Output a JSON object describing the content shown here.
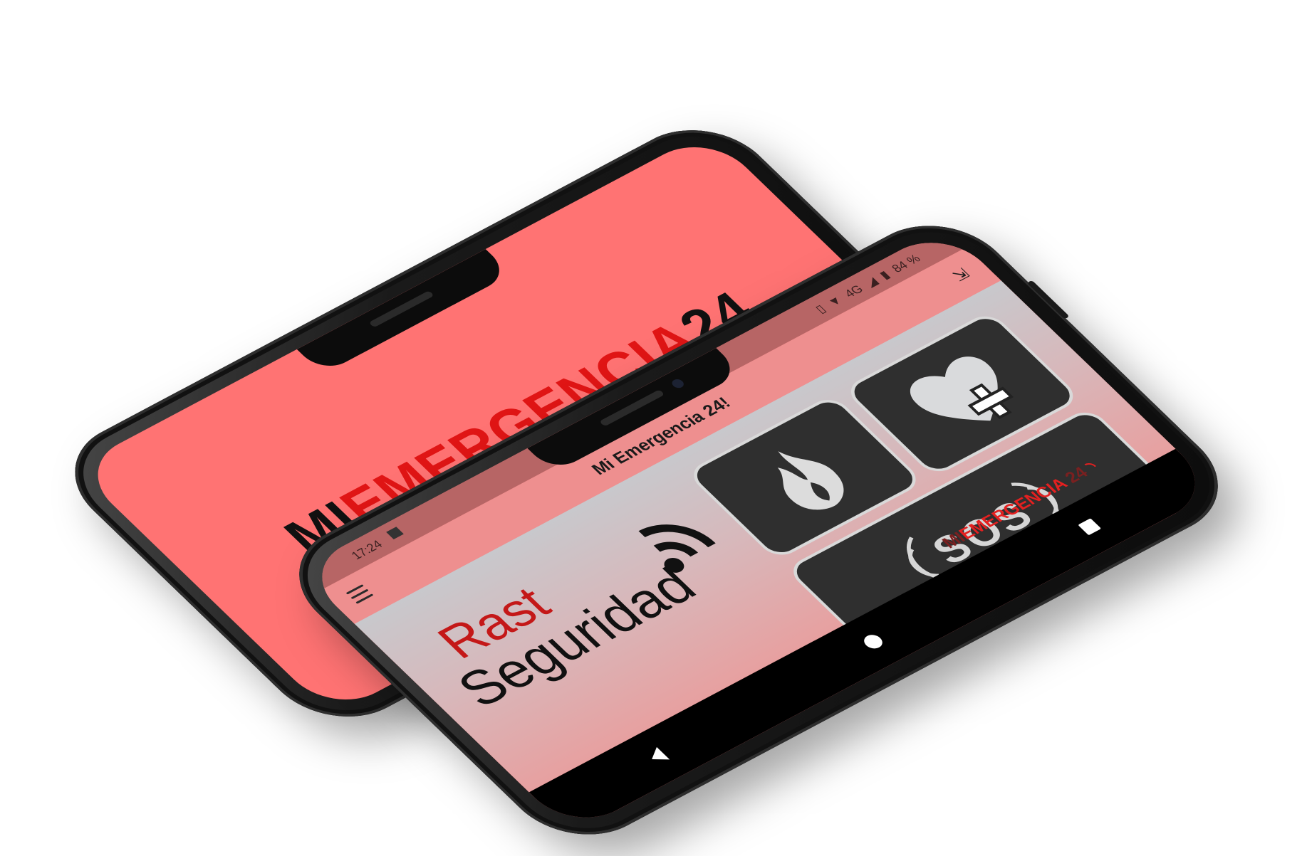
{
  "splash": {
    "brand_prefix": "MI",
    "brand_main": "EMERGENCIA",
    "brand_number": "24"
  },
  "status_bar": {
    "time": "17:24",
    "network": "4G",
    "battery": "84 %"
  },
  "app_bar": {
    "title": "Mi Emergencia 24!"
  },
  "logo": {
    "line1": "Rast",
    "line2": "Seguridad"
  },
  "tiles": {
    "fire_icon": "fire-icon",
    "heart_icon": "heart-medical-icon",
    "sos_label": "SOS"
  },
  "footer_brand": {
    "prefix": "MI",
    "main": "EMERGENCIA",
    "number": "24"
  },
  "colors": {
    "splash_bg": "#ff7373",
    "accent_red": "#e01515",
    "tile_bg": "#2f2f2f",
    "status_bar": "#b76565",
    "app_bar": "#ee8f8f"
  }
}
